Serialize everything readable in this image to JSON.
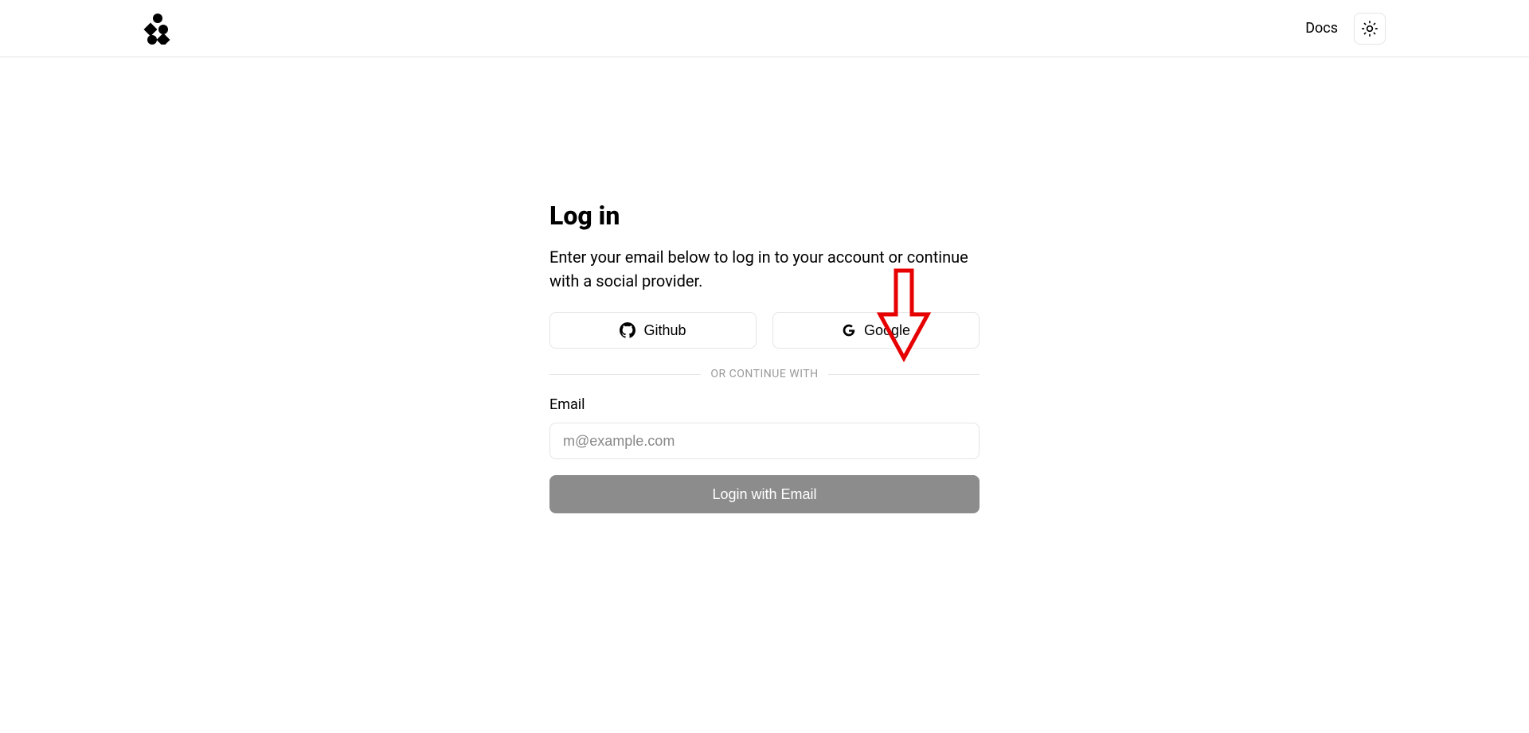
{
  "header": {
    "docs_label": "Docs"
  },
  "login": {
    "title": "Log in",
    "subtitle": "Enter your email below to log in to your account or continue with a social provider.",
    "github_label": "Github",
    "google_label": "Google",
    "divider_text": "OR CONTINUE WITH",
    "email_label": "Email",
    "email_placeholder": "m@example.com",
    "submit_label": "Login with Email"
  }
}
